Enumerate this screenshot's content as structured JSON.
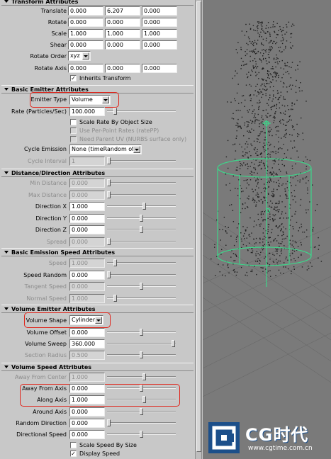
{
  "transform": {
    "title": "Transform Attributes",
    "translate": {
      "label": "Translate",
      "v": [
        "0.000",
        "6.207",
        "0.000"
      ]
    },
    "rotate": {
      "label": "Rotate",
      "v": [
        "0.000",
        "0.000",
        "0.000"
      ]
    },
    "scale": {
      "label": "Scale",
      "v": [
        "1.000",
        "1.000",
        "1.000"
      ]
    },
    "shear": {
      "label": "Shear",
      "v": [
        "0.000",
        "0.000",
        "0.000"
      ]
    },
    "rotate_order": {
      "label": "Rotate Order",
      "value": "xyz"
    },
    "rotate_axis": {
      "label": "Rotate Axis",
      "v": [
        "0.000",
        "0.000",
        "0.000"
      ]
    },
    "inherits_transform": {
      "label": "Inherits Transform",
      "checked": true
    }
  },
  "basic_emitter": {
    "title": "Basic Emitter Attributes",
    "emitter_type": {
      "label": "Emitter Type",
      "value": "Volume"
    },
    "rate": {
      "label": "Rate (Particles/Sec)",
      "value": "100.000",
      "slider": 0.1
    },
    "scale_rate": {
      "label": "Scale Rate By Object Size",
      "checked": false
    },
    "per_point": {
      "label": "Use Per-Point Rates (ratePP)",
      "checked": false
    },
    "need_uv": {
      "label": "Need Parent UV (NURBS surface only)",
      "checked": false
    },
    "cycle_emission": {
      "label": "Cycle Emission",
      "value": "None (timeRandom off)"
    },
    "cycle_interval": {
      "label": "Cycle Interval",
      "value": "1",
      "slider": 0.0
    }
  },
  "distance": {
    "title": "Distance/Direction Attributes",
    "rows": [
      {
        "label": "Min Distance",
        "value": "0.000",
        "dim": true,
        "slider": 0.0
      },
      {
        "label": "Max Distance",
        "value": "0.000",
        "dim": true,
        "slider": 0.0
      },
      {
        "label": "Direction X",
        "value": "1.000",
        "dim": false,
        "slider": 0.55
      },
      {
        "label": "Direction Y",
        "value": "0.000",
        "dim": false,
        "slider": 0.5
      },
      {
        "label": "Direction Z",
        "value": "0.000",
        "dim": false,
        "slider": 0.5
      },
      {
        "label": "Spread",
        "value": "0.000",
        "dim": true,
        "slider": 0.0
      }
    ]
  },
  "speed": {
    "title": "Basic Emission Speed Attributes",
    "rows": [
      {
        "label": "Speed",
        "value": "1.000",
        "dim": true,
        "slider": 0.1
      },
      {
        "label": "Speed Random",
        "value": "0.000",
        "dim": false,
        "slider": 0.0
      },
      {
        "label": "Tangent Speed",
        "value": "0.000",
        "dim": true,
        "slider": 0.5
      },
      {
        "label": "Normal Speed",
        "value": "1.000",
        "dim": true,
        "slider": 0.1
      }
    ]
  },
  "volume_emitter": {
    "title": "Volume Emitter Attributes",
    "shape": {
      "label": "Volume Shape",
      "value": "Cylinder"
    },
    "rows": [
      {
        "label": "Volume Offset",
        "value": "0.000",
        "dim": false,
        "slider": 0.5
      },
      {
        "label": "Volume Sweep",
        "value": "360.000",
        "dim": false,
        "slider": 1.0
      },
      {
        "label": "Section Radius",
        "value": "0.500",
        "dim": true,
        "slider": 0.5
      }
    ]
  },
  "volume_speed": {
    "title": "Volume Speed Attributes",
    "rows": [
      {
        "label": "Away From Center",
        "value": "1.000",
        "dim": true,
        "slider": 0.55
      },
      {
        "label": "Away From Axis",
        "value": "0.000",
        "dim": false,
        "slider": 0.5
      },
      {
        "label": "Along Axis",
        "value": "1.000",
        "dim": false,
        "slider": 0.55
      },
      {
        "label": "Around Axis",
        "value": "0.000",
        "dim": false,
        "slider": 0.5
      },
      {
        "label": "Random Direction",
        "value": "0.000",
        "dim": false,
        "slider": 0.0
      },
      {
        "label": "Directional Speed",
        "value": "0.000",
        "dim": false,
        "slider": 0.5
      }
    ],
    "scale_speed": {
      "label": "Scale Speed By Size",
      "checked": false
    },
    "display_speed": {
      "label": "Display Speed",
      "checked": true
    }
  },
  "logo": {
    "brand": "CG时代",
    "url": "www.cgtime.com.cn"
  },
  "colors": {
    "highlight": "#e0251b",
    "manipulator": "#3dd68a",
    "particle": "#1e1e1e"
  }
}
